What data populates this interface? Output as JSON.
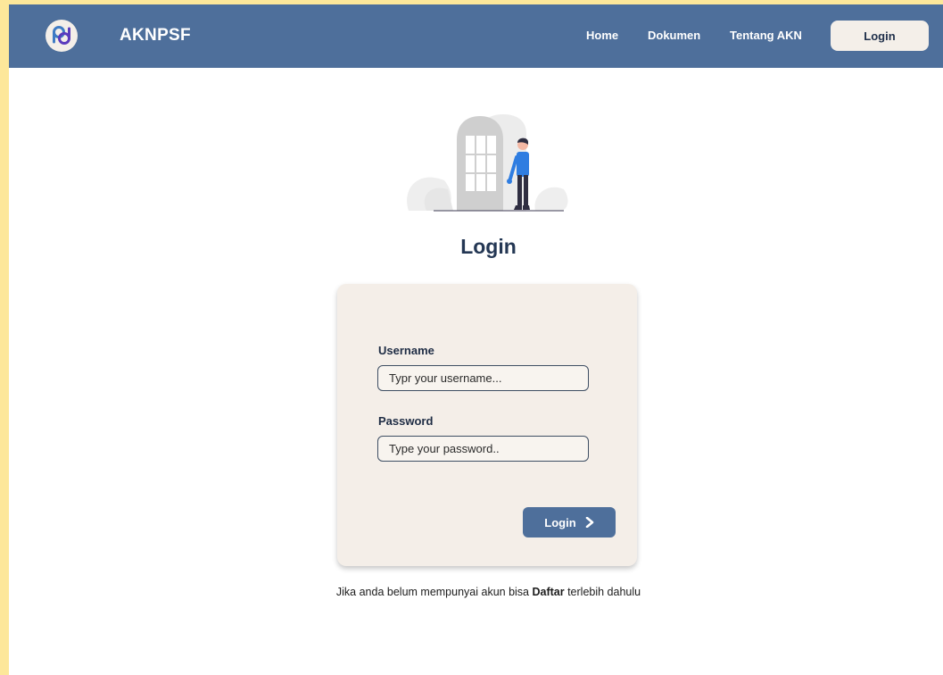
{
  "header": {
    "brand": "AKNPSF",
    "nav": [
      "Home",
      "Dokumen",
      "Tentang AKN"
    ],
    "login_button": "Login"
  },
  "main": {
    "title": "Login",
    "form": {
      "username_label": "Username",
      "username_placeholder": "Typr your username...",
      "password_label": "Password",
      "password_placeholder": "Type your password..",
      "submit_label": "Login"
    },
    "register_prompt": {
      "before": "Jika anda belum mempunyai akun bisa ",
      "link": "Daftar",
      "after": " terlebih dahulu"
    }
  },
  "colors": {
    "navbar": "#4e6f9b",
    "card": "#f4eee8",
    "outer_background": "#fde79a"
  },
  "icons": [
    "logo-icon",
    "chevron-right-icon",
    "login-door-illustration"
  ]
}
